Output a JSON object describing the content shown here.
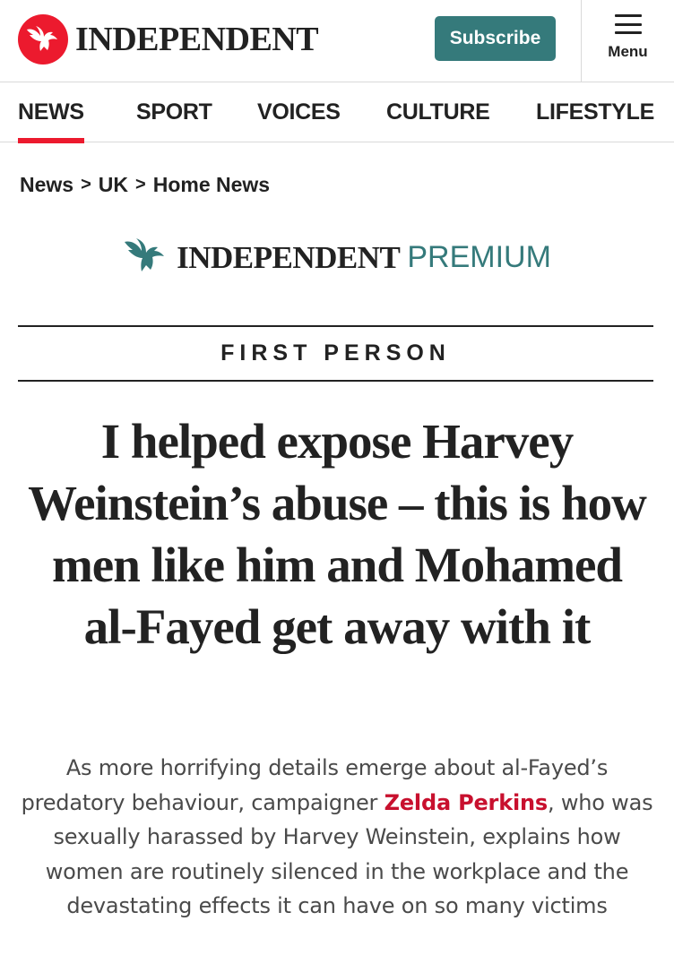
{
  "header": {
    "logo_text": "INDEPENDENT",
    "subscribe_label": "Subscribe",
    "menu_label": "Menu",
    "brand_red": "#ec1a2e",
    "brand_teal": "#357a7b"
  },
  "nav": {
    "items": [
      {
        "label": "NEWS",
        "active": true
      },
      {
        "label": "SPORT",
        "active": false
      },
      {
        "label": "VOICES",
        "active": false
      },
      {
        "label": "CULTURE",
        "active": false
      },
      {
        "label": "LIFESTYLE",
        "active": false
      }
    ]
  },
  "breadcrumb": {
    "items": [
      "News",
      "UK",
      "Home News"
    ],
    "separator": ">"
  },
  "premium": {
    "logo_text": "INDEPENDENT",
    "premium_label": "PREMIUM"
  },
  "article": {
    "section_label": "FIRST PERSON",
    "headline": "I helped expose Harvey Weinstein’s abuse – this is how men like him and Mohamed al-Fayed get away with it",
    "standfirst_before": "As more horrifying details emerge about al-Fayed’s predatory behaviour, campaigner ",
    "author_link": "Zelda Perkins",
    "standfirst_after": ", who was sexually harassed by Harvey Weinstein, explains how women are routinely silenced in the workplace and the devastating effects it can have on so many victims"
  },
  "icons": {
    "logo": "eagle-icon",
    "menu": "hamburger-menu-icon",
    "premium_logo": "eagle-icon"
  }
}
